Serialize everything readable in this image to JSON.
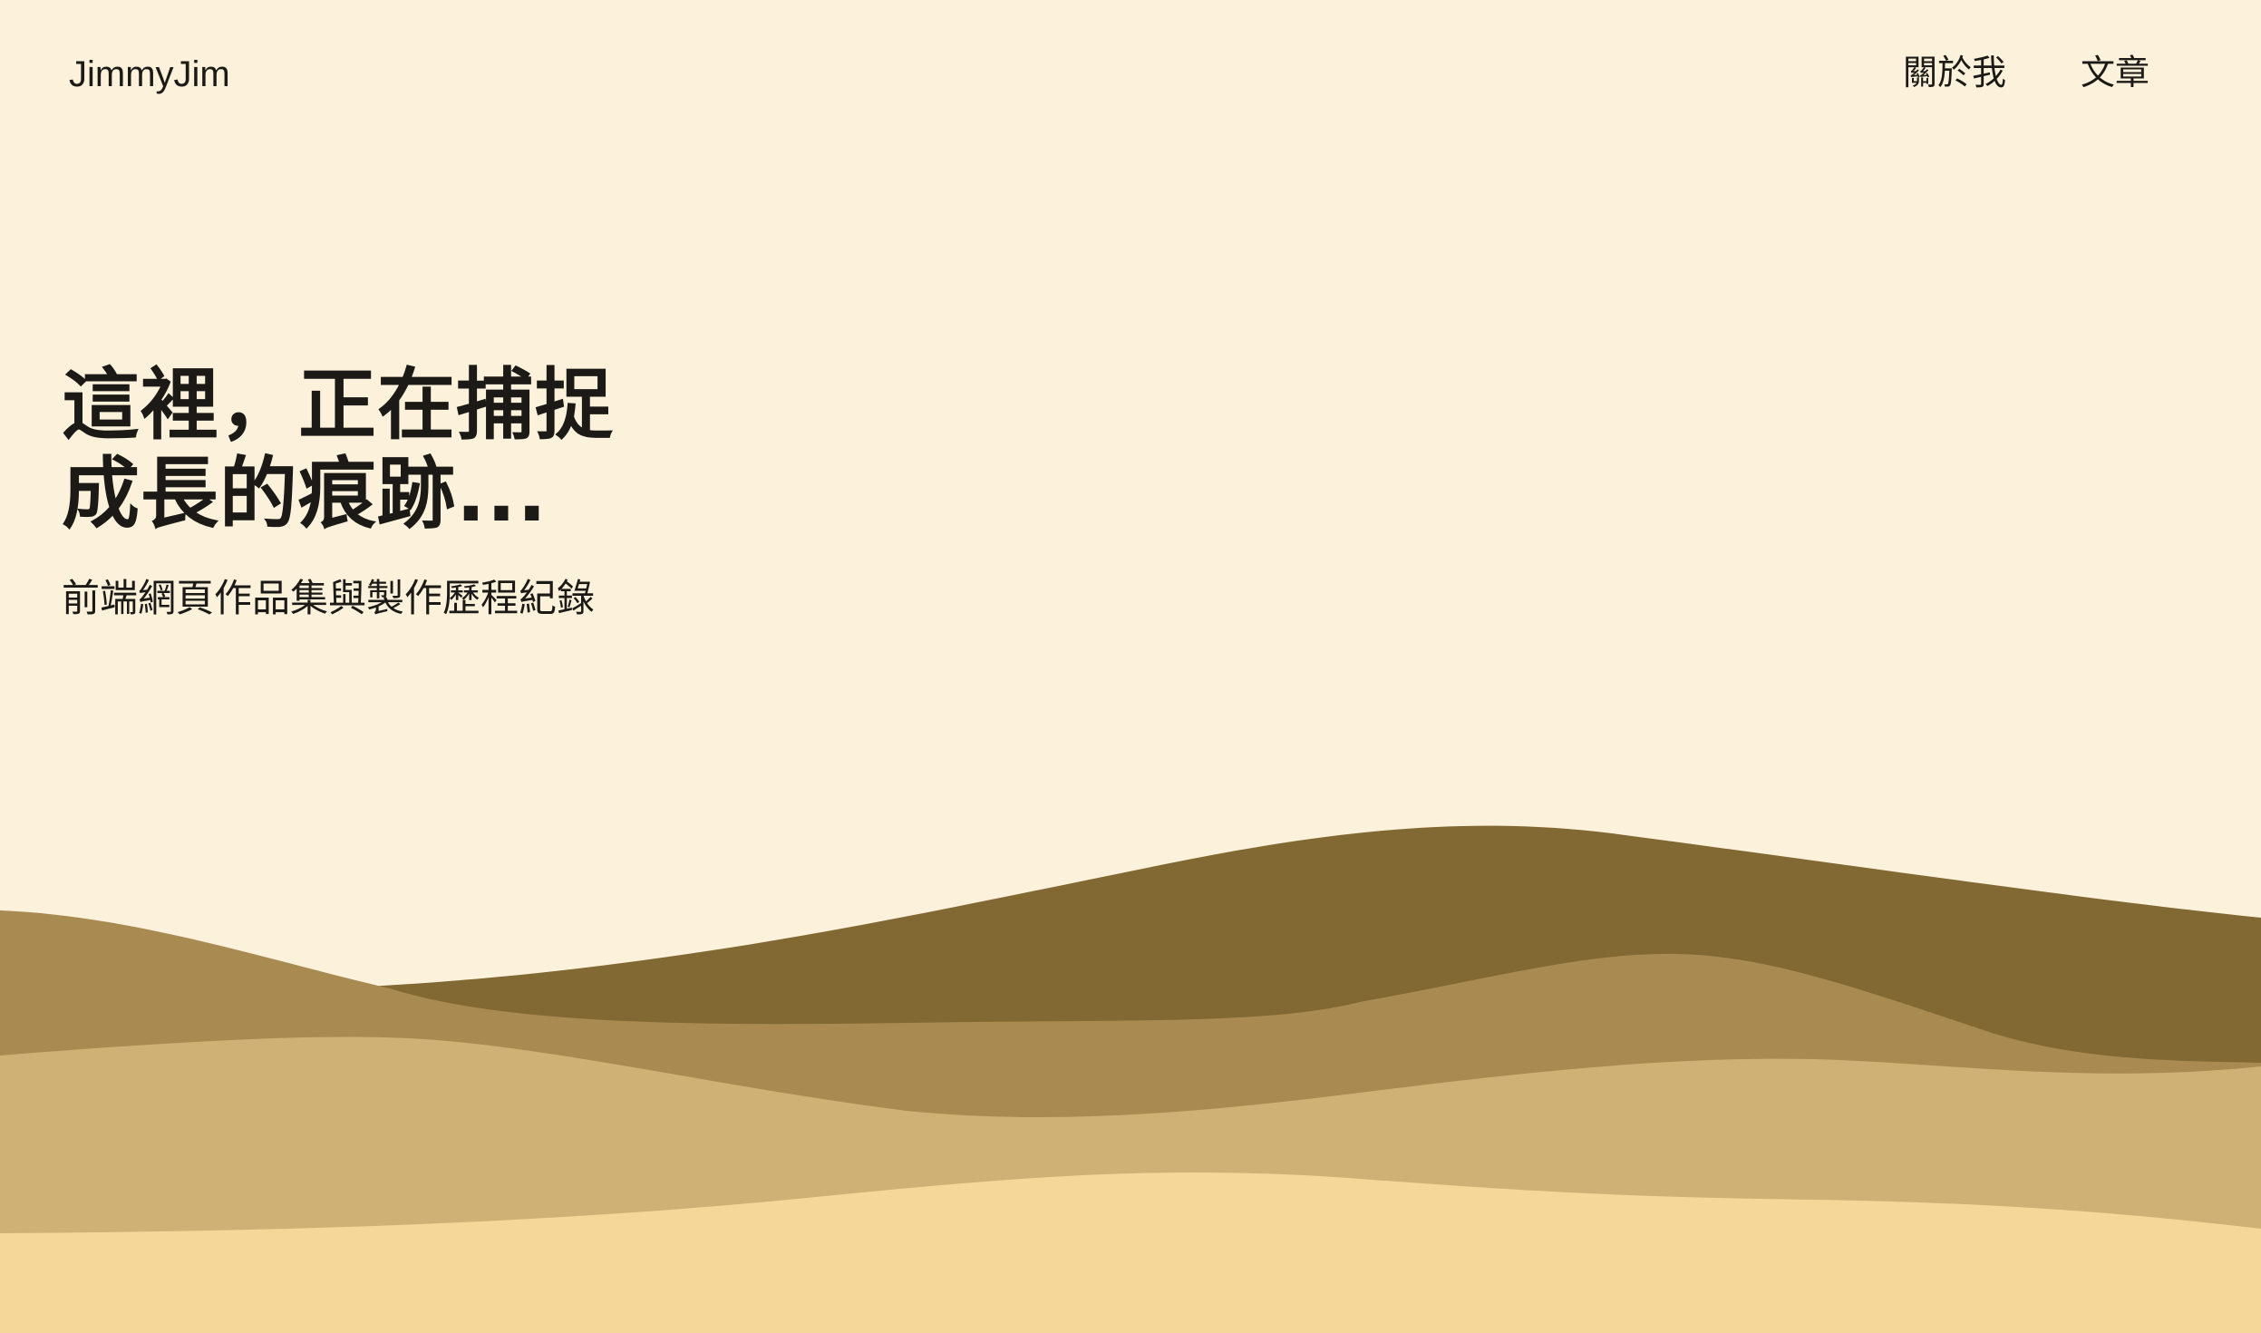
{
  "header": {
    "logo": "JimmyJim",
    "nav": [
      {
        "label": "關於我"
      },
      {
        "label": "文章"
      }
    ]
  },
  "hero": {
    "title_line1": "這裡，正在捕捉",
    "title_line2": "成長的痕跡...",
    "subtitle": "前端網頁作品集與製作歷程紀錄"
  },
  "theme": {
    "background": "#FCF2DC",
    "text": "#1C1A17",
    "dune_colors": [
      "#826833",
      "#A98B52",
      "#CFB175",
      "#F5D799"
    ]
  }
}
